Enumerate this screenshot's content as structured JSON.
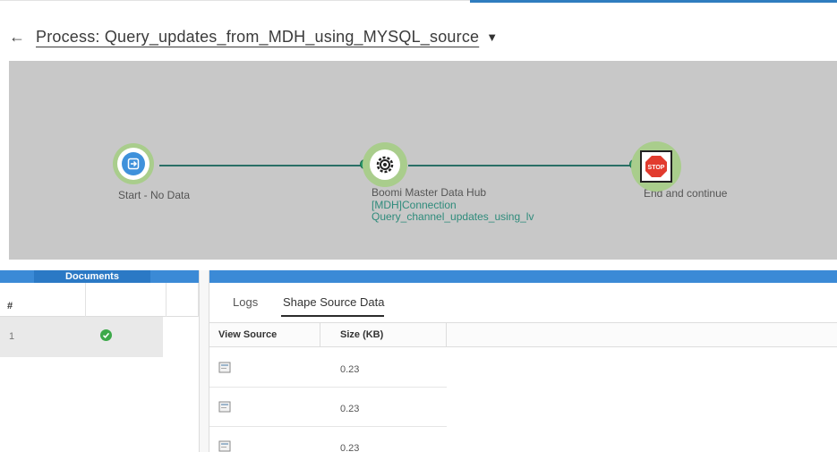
{
  "header": {
    "back_icon": "left-arrow-icon",
    "process_title": "Process: Query_updates_from_MDH_using_MYSQL_source",
    "caret_icon": "caret-down-icon"
  },
  "canvas": {
    "shapes": [
      {
        "name": "start",
        "icon": "start-arrow-icon",
        "label": "Start - No Data"
      },
      {
        "name": "connector",
        "icon": "gear-icon",
        "label": "Boomi Master Data Hub",
        "sublines": [
          "[MDH]Connection",
          "Query_channel_updates_using_lv"
        ]
      },
      {
        "name": "end",
        "icon": "stop-sign-icon",
        "label": "End and continue",
        "badge_text": "STOP"
      }
    ],
    "colors": {
      "background": "#c8c8c8",
      "halo": "#a9cd8c",
      "connector": "#2a6f66",
      "sublabel": "#2e8b7b"
    }
  },
  "documents": {
    "header": "Documents",
    "column_hash": "#",
    "rows": [
      {
        "number": "1",
        "status_icon": "check-circle-icon"
      }
    ]
  },
  "results": {
    "tabs": [
      {
        "label": "Logs",
        "active": false
      },
      {
        "label": "Shape Source Data",
        "active": true
      }
    ],
    "columns": [
      "View Source",
      "Size (KB)"
    ],
    "rows": [
      {
        "icon": "document-icon",
        "size": "0.23"
      },
      {
        "icon": "document-icon",
        "size": "0.23"
      },
      {
        "icon": "document-icon",
        "size": "0.23"
      }
    ],
    "accent": "#3b8ad6"
  }
}
